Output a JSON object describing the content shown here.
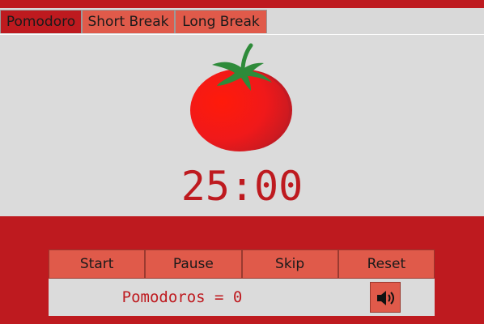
{
  "tabs": [
    {
      "label": "Pomodoro",
      "active": true
    },
    {
      "label": "Short Break",
      "active": false
    },
    {
      "label": "Long Break",
      "active": false
    }
  ],
  "timer": {
    "display": "25:00"
  },
  "controls": {
    "start_label": "Start",
    "pause_label": "Pause",
    "skip_label": "Skip",
    "reset_label": "Reset"
  },
  "counter": {
    "text": "Pomodoros = 0"
  },
  "icons": {
    "tomato": "tomato-icon",
    "sound": "speaker-icon"
  },
  "colors": {
    "brand_red": "#be1a1f",
    "button_red": "#e05a4a",
    "panel_gray": "#dbdbdb",
    "leaf_green": "#2e8b3a"
  }
}
